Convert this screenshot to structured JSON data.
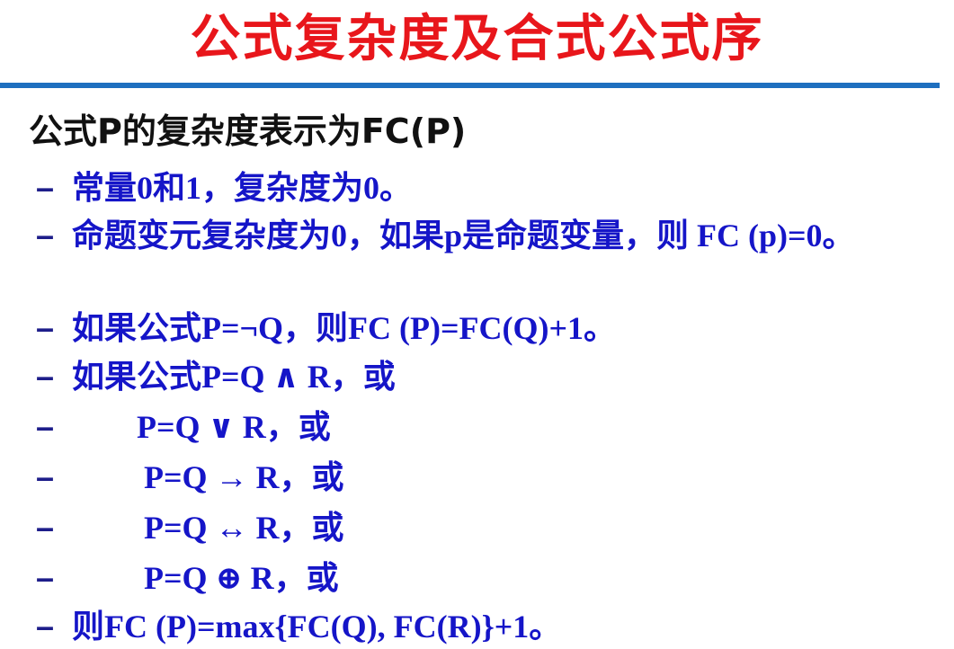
{
  "title": "公式复杂度及合式公式序",
  "heading": "公式P的复杂度表示为FC(P)",
  "bullets": [
    {
      "dash": "–",
      "text": "常量0和1，复杂度为0。"
    },
    {
      "dash": "–",
      "text": "命题变元复杂度为0，如果p是命题变量，则   FC (p)=0。"
    },
    {
      "dash": "–",
      "text": "如果公式P=¬Q，则FC (P)=FC(Q)+1。"
    },
    {
      "dash": "–",
      "text": "如果公式P=Q ∧ R，或"
    },
    {
      "dash": "–",
      "text": "P=Q ∨ R，或"
    },
    {
      "dash": "–",
      "text": "P=Q → R，或"
    },
    {
      "dash": "–",
      "text": "P=Q ↔ R，或"
    },
    {
      "dash": "–",
      "text": "P=Q ⊕ R，或"
    },
    {
      "dash": "–",
      "text": "则FC (P)=max{FC(Q), FC(R)}+1。"
    }
  ]
}
